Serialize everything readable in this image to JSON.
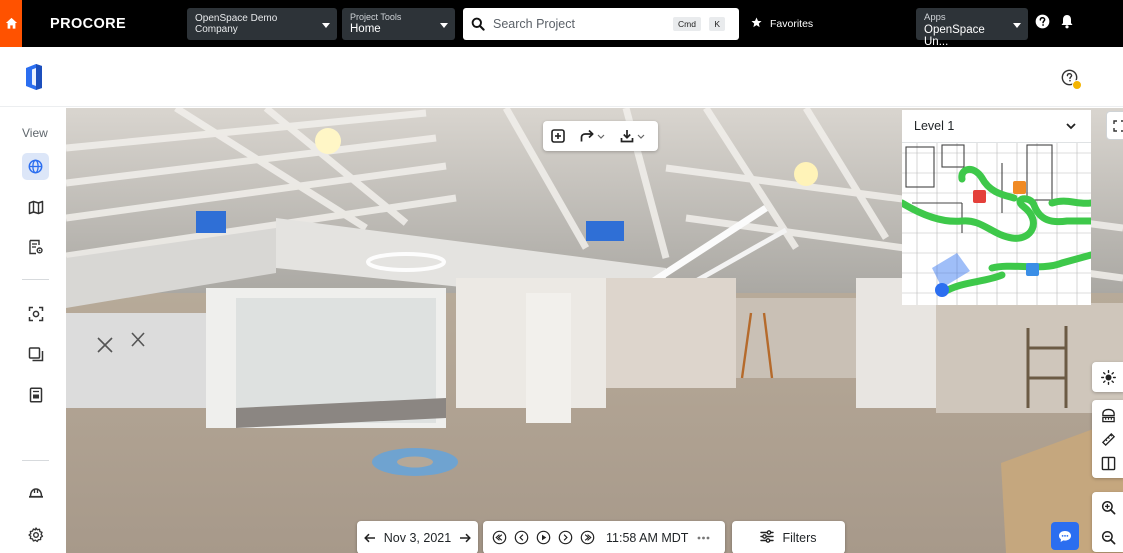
{
  "header": {
    "logo": "PROCORE",
    "company": {
      "label": "OpenSpace Demo Company"
    },
    "project_tools": {
      "label": "Project Tools",
      "value": "Home"
    },
    "search": {
      "placeholder": "Search Project",
      "shortcut_1": "Cmd",
      "shortcut_2": "K"
    },
    "favorites_label": "Favorites",
    "apps": {
      "label": "Apps",
      "value": "OpenSpace Un..."
    },
    "brand_color": "#ff5200"
  },
  "sidebar": {
    "view_label": "View",
    "items": [
      {
        "icon": "globe-icon",
        "active": true
      },
      {
        "icon": "map-icon",
        "active": false
      },
      {
        "icon": "list-settings-icon",
        "active": false
      },
      {
        "icon": "focus-icon",
        "active": false
      },
      {
        "icon": "compare-icon",
        "active": false
      },
      {
        "icon": "report-icon",
        "active": false
      },
      {
        "icon": "helmet-icon",
        "active": false
      },
      {
        "icon": "gear-icon",
        "active": false
      }
    ],
    "accent_color": "#2b6ef0"
  },
  "viewer": {
    "toolbar": [
      "add-icon",
      "share-icon",
      "download-icon"
    ],
    "level_select": "Level 1",
    "date": "Nov 3, 2021",
    "time": "11:58 AM MDT",
    "filters_label": "Filters"
  }
}
